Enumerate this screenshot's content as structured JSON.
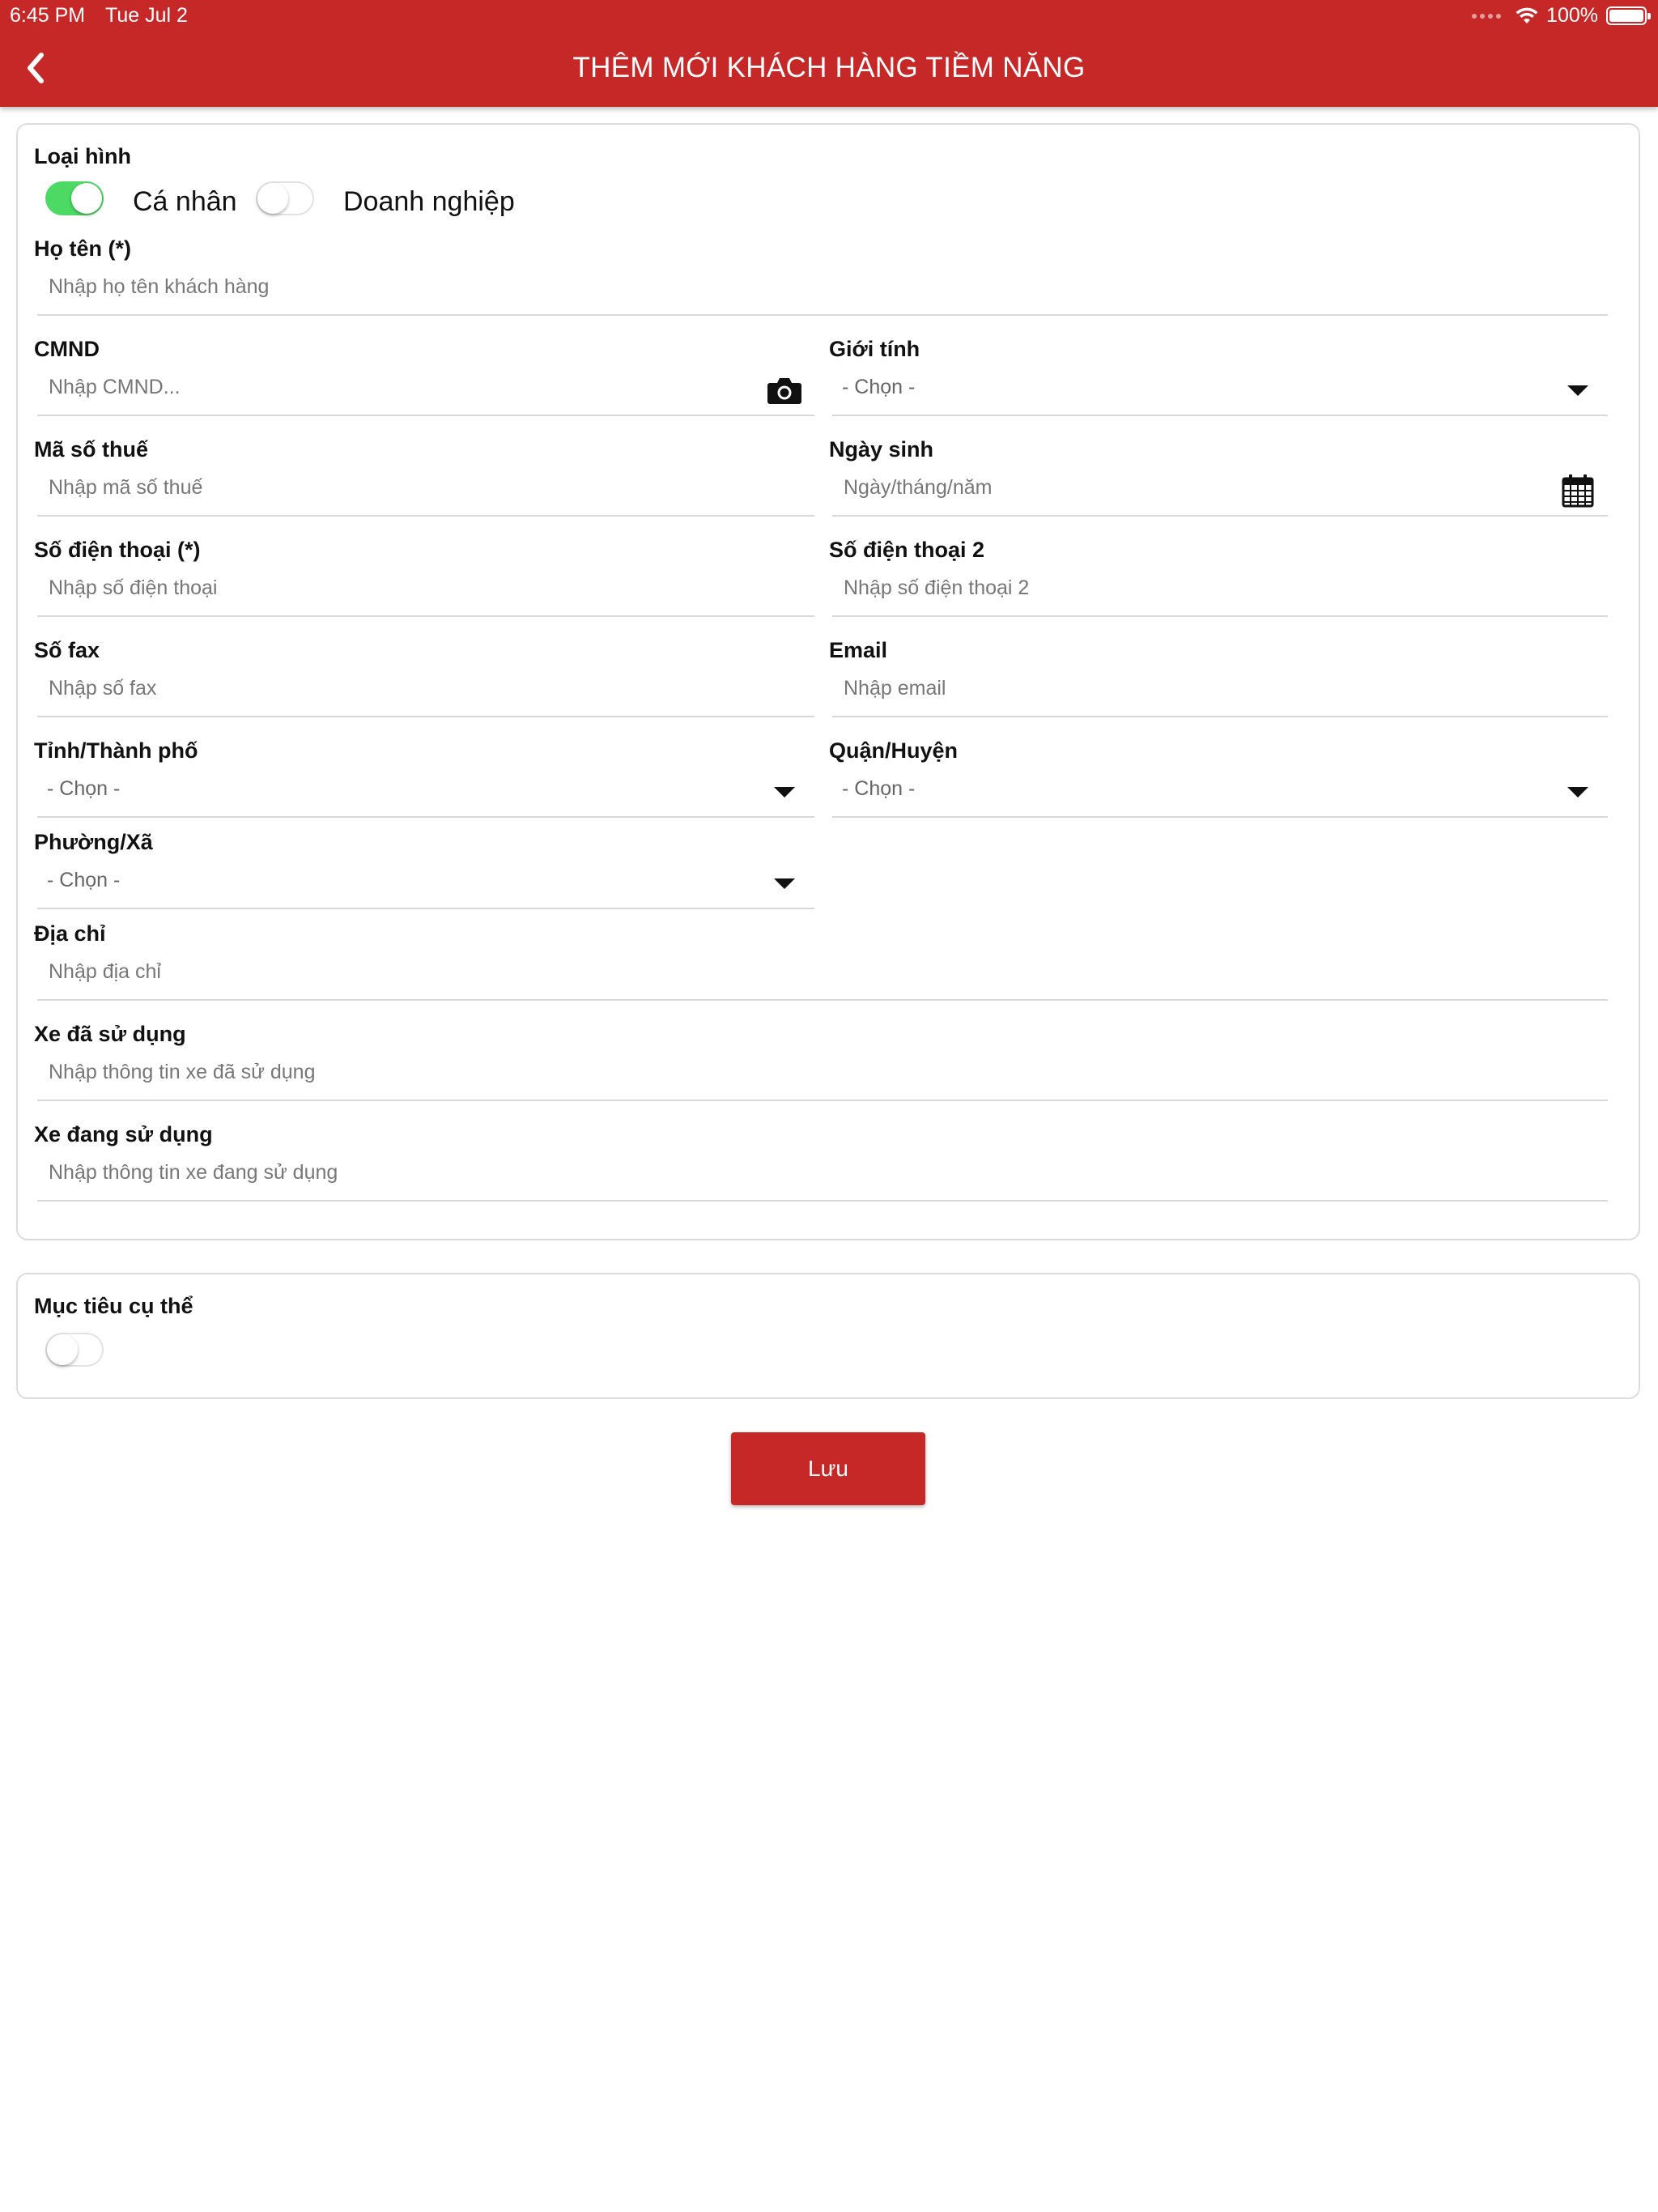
{
  "status_bar": {
    "time": "6:45 PM",
    "date": "Tue Jul 2",
    "battery": "100%"
  },
  "header": {
    "title": "THÊM MỚI KHÁCH HÀNG TIỀM NĂNG"
  },
  "colors": {
    "brand": "#c62828",
    "toggle_on": "#4cd964"
  },
  "customer_type": {
    "label": "Loại hình",
    "options": [
      {
        "label": "Cá nhân",
        "checked": true
      },
      {
        "label": "Doanh nghiệp",
        "checked": false
      }
    ]
  },
  "fields": {
    "full_name": {
      "label": "Họ tên (*)",
      "placeholder": "Nhập họ tên khách hàng"
    },
    "id_card": {
      "label": "CMND",
      "placeholder": "Nhập CMND..."
    },
    "gender": {
      "label": "Giới tính",
      "value": "- Chọn -"
    },
    "tax_code": {
      "label": "Mã số thuế",
      "placeholder": "Nhập mã số thuế"
    },
    "birthday": {
      "label": "Ngày sinh",
      "placeholder": "Ngày/tháng/năm"
    },
    "phone": {
      "label": "Số điện thoại (*)",
      "placeholder": "Nhập số điện thoại"
    },
    "phone2": {
      "label": "Số điện thoại 2",
      "placeholder": "Nhập số điện thoại 2"
    },
    "fax": {
      "label": "Số fax",
      "placeholder": "Nhập số fax"
    },
    "email": {
      "label": "Email",
      "placeholder": "Nhập email"
    },
    "province": {
      "label": "Tỉnh/Thành phố",
      "value": "- Chọn -"
    },
    "district": {
      "label": "Quận/Huyện",
      "value": "- Chọn -"
    },
    "ward": {
      "label": "Phường/Xã",
      "value": "- Chọn -"
    },
    "address": {
      "label": "Địa chỉ",
      "placeholder": "Nhập địa chỉ"
    },
    "used_vehicle": {
      "label": "Xe đã sử dụng",
      "placeholder": "Nhập thông tin xe đã sử dụng"
    },
    "current_vehicle": {
      "label": "Xe đang sử dụng",
      "placeholder": "Nhập thông tin xe đang sử dụng"
    }
  },
  "goal": {
    "label": "Mục tiêu cụ thể",
    "enabled": false
  },
  "actions": {
    "save_label": "Lưu"
  },
  "icons": {
    "back": "chevron-left-icon",
    "camera": "camera-icon",
    "calendar": "calendar-icon",
    "dropdown": "caret-down-icon"
  }
}
